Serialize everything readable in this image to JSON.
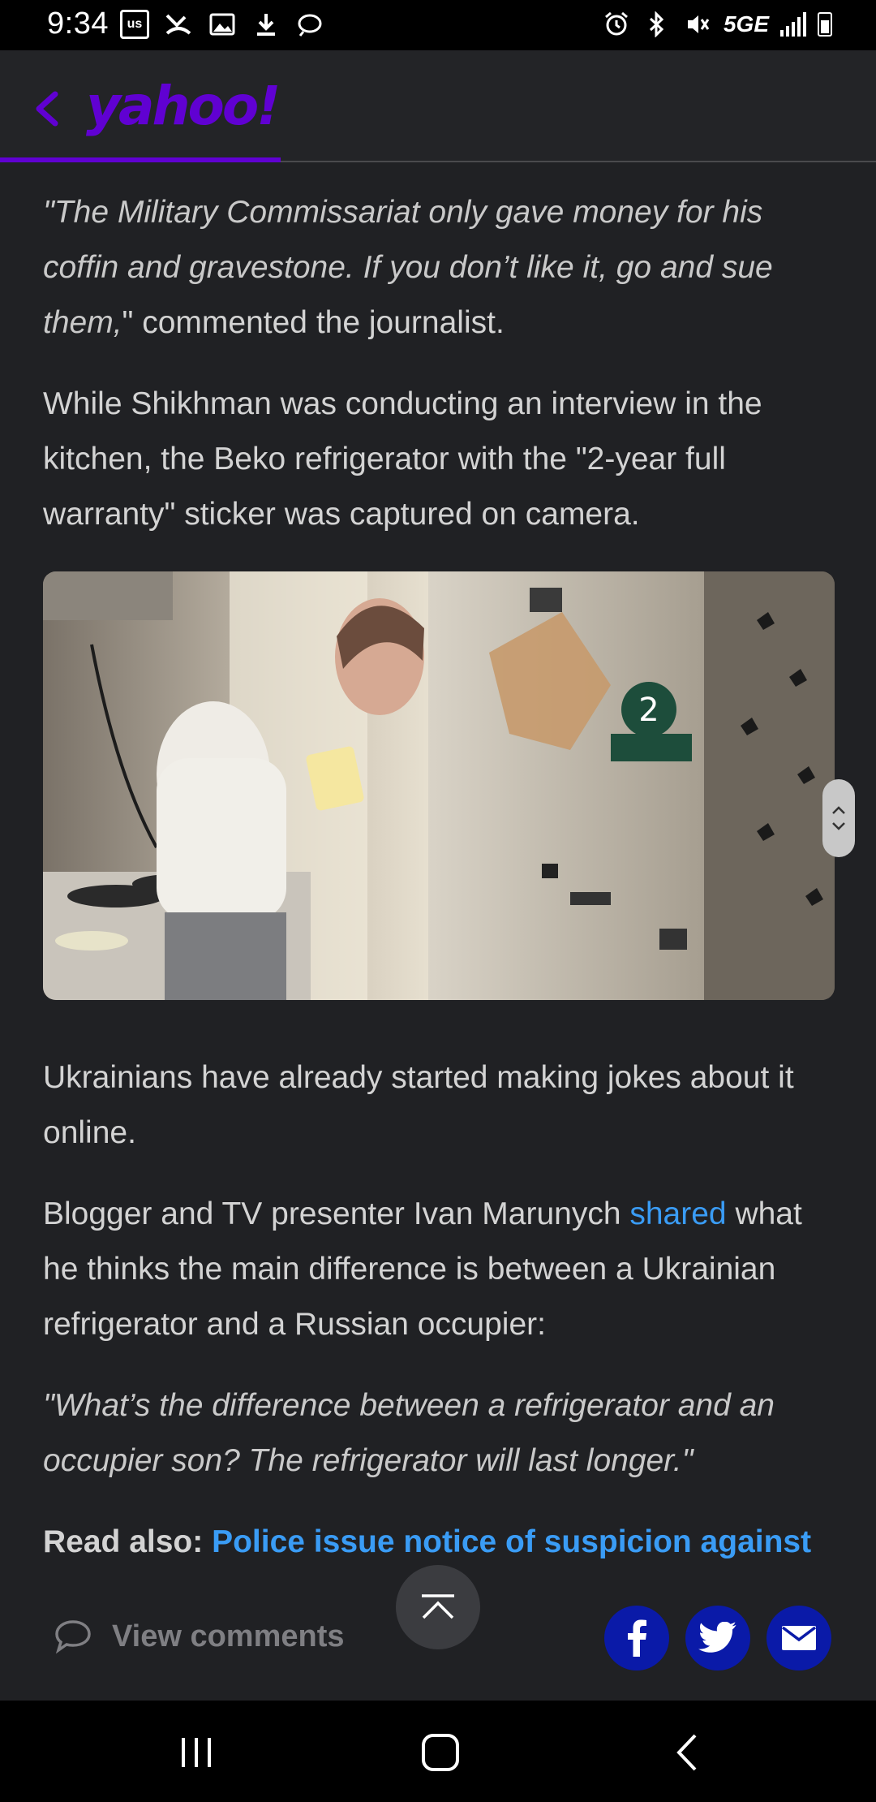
{
  "status_bar": {
    "time": "9:34",
    "left_icons": [
      "us-badge-icon",
      "missed-call-icon",
      "image-icon",
      "download-icon",
      "cast-icon"
    ],
    "right_icons": [
      "alarm-icon",
      "bluetooth-icon",
      "mute-icon",
      "5g-icon",
      "signal-icon",
      "battery-icon"
    ],
    "us_label": "us",
    "network": "5GE"
  },
  "header": {
    "logo": "yahoo!",
    "brand_color": "#6001d2",
    "reading_progress": 0.32
  },
  "article": {
    "quote1_italic": "\"The Military Commissariat only gave money for his coffin and gravestone. If you don’t like it, go and sue them,",
    "quote1_tail": "\" commented the journalist.",
    "para2": "While Shikhman was conducting an interview in the kitchen, the Beko refrigerator with the \"2-year full warranty\" sticker was captured on camera.",
    "para3": "Ukrainians have already started making jokes about it online.",
    "para4_before": "Blogger and TV presenter Ivan Marunych ",
    "para4_link": "shared",
    "para4_after": " what he thinks the main difference is between a Ukrainian refrigerator and a Russian occupier:",
    "quote2": "\"What’s the difference between a refrigerator and an occupier son? The refrigerator will last longer.\"",
    "read_also_label": "Read also: ",
    "read_also_link": "Police issue notice of suspicion against",
    "link_color": "#3a9cf5"
  },
  "bottom_bar": {
    "view_comments": "View comments",
    "share_buttons": [
      "facebook-icon",
      "twitter-icon",
      "mail-icon"
    ]
  },
  "nav_bar": {
    "buttons": [
      "recents-icon",
      "home-icon",
      "back-icon"
    ]
  }
}
